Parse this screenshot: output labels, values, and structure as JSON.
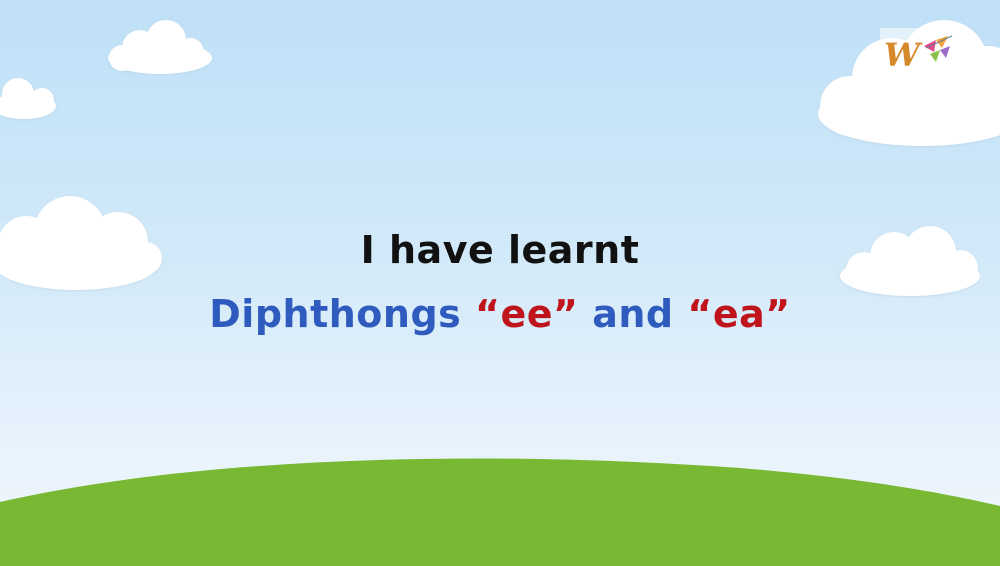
{
  "slide": {
    "line1": "I have learnt",
    "line2": {
      "part1": "Diphthongs ",
      "digraph1": "“ee”",
      "part2": " and ",
      "digraph2": "“ea”"
    }
  },
  "colors": {
    "heading": "#111111",
    "subheading": "#2f5bbf",
    "highlight": "#c0141c",
    "grass": "#79b833",
    "cloud": "#ffffff"
  },
  "logo": {
    "icon": "w-logo-icon"
  }
}
